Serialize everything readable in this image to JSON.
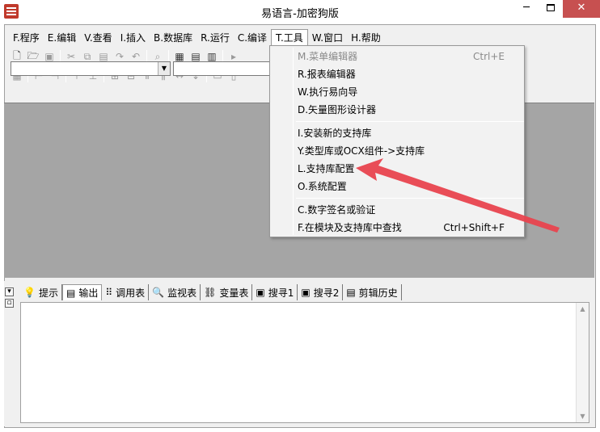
{
  "window": {
    "title": "易语言-加密狗版",
    "minimize": "─",
    "close": "✕"
  },
  "menu": [
    {
      "label": "F.程序"
    },
    {
      "label": "E.编辑"
    },
    {
      "label": "V.查看"
    },
    {
      "label": "I.插入"
    },
    {
      "label": "B.数据库"
    },
    {
      "label": "R.运行"
    },
    {
      "label": "C.编译"
    },
    {
      "label": "T.工具",
      "active": true
    },
    {
      "label": "W.窗口"
    },
    {
      "label": "H.帮助"
    }
  ],
  "toolbar": {
    "new_icon": "🗋",
    "open_icon": "🗁",
    "save_icon": "▣",
    "cut_icon": "✂",
    "copy_icon": "⧉",
    "paste_icon": "▤",
    "redo_icon": "↷",
    "undo_icon": "↶",
    "find_icon": "⌕",
    "layout1_icon": "▦",
    "layout2_icon": "▤",
    "layout3_icon": "▥",
    "run_icon": "▸"
  },
  "tools_menu": {
    "items": [
      {
        "label": "M.菜单编辑器",
        "shortcut": "Ctrl+E",
        "disabled": true
      },
      {
        "label": "R.报表编辑器",
        "shortcut": ""
      },
      {
        "label": "W.执行易向导",
        "shortcut": ""
      },
      {
        "label": "D.矢量图形设计器",
        "shortcut": ""
      },
      {
        "label": "I.安装新的支持库",
        "shortcut": ""
      },
      {
        "label": "Y.类型库或OCX组件->支持库",
        "shortcut": ""
      },
      {
        "label": "L.支持库配置",
        "shortcut": ""
      },
      {
        "label": "O.系统配置",
        "shortcut": ""
      },
      {
        "label": "C.数字签名或验证",
        "shortcut": ""
      },
      {
        "label": "F.在模块及支持库中查找",
        "shortcut": "Ctrl+Shift+F"
      }
    ]
  },
  "bottom_tabs": [
    {
      "label": "提示",
      "icon": "💡"
    },
    {
      "label": "输出",
      "icon": "▤",
      "selected": true
    },
    {
      "label": "调用表",
      "icon": "⠿"
    },
    {
      "label": "监视表",
      "icon": "🔍"
    },
    {
      "label": "变量表",
      "icon": "⛓"
    },
    {
      "label": "搜寻1",
      "icon": "▣"
    },
    {
      "label": "搜寻2",
      "icon": "▣"
    },
    {
      "label": "剪辑历史",
      "icon": "▤"
    }
  ],
  "colors": {
    "workspace": "#a5a5a5",
    "annotation_arrow": "#e8434e"
  }
}
